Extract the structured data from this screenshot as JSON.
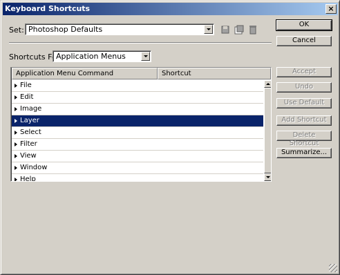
{
  "window": {
    "title": "Keyboard Shortcuts",
    "close_glyph": "×"
  },
  "set": {
    "label": "Set:",
    "value": "Photoshop Defaults",
    "icons": [
      "save-set-icon",
      "save-as-set-icon",
      "delete-set-icon"
    ]
  },
  "shortcuts_for": {
    "label": "Shortcuts For:",
    "value": "Application Menus"
  },
  "table": {
    "columns": [
      "Application Menu Command",
      "Shortcut"
    ],
    "rows": [
      {
        "label": "File",
        "selected": false
      },
      {
        "label": "Edit",
        "selected": false
      },
      {
        "label": "Image",
        "selected": false
      },
      {
        "label": "Layer",
        "selected": true
      },
      {
        "label": "Select",
        "selected": false
      },
      {
        "label": "Filter",
        "selected": false
      },
      {
        "label": "View",
        "selected": false
      },
      {
        "label": "Window",
        "selected": false
      },
      {
        "label": "Help",
        "selected": false
      }
    ]
  },
  "buttons": {
    "ok": "OK",
    "cancel": "Cancel",
    "accept": "Accept",
    "undo": "Undo",
    "use_default": "Use Default",
    "add_shortcut": "Add Shortcut",
    "delete_shortcut": "Delete Shortcut",
    "summarize": "Summarize..."
  },
  "colors": {
    "dialog_bg": "#d4d0c8",
    "title_gradient_start": "#0a246a",
    "title_gradient_end": "#a6caf0",
    "selection": "#0a246a"
  }
}
